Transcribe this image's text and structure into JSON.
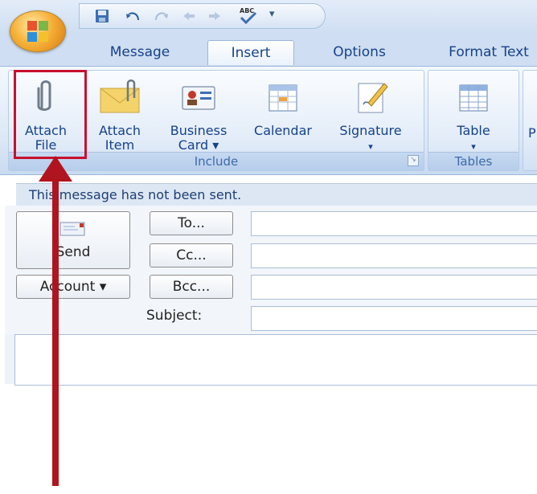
{
  "qat": {
    "icons": [
      "save-icon",
      "undo-icon",
      "redo-icon",
      "previous-item-icon",
      "next-item-icon",
      "spelling-icon"
    ],
    "customize_glyph": "▾"
  },
  "tabs": [
    "Message",
    "Insert",
    "Options",
    "Format Text"
  ],
  "ribbon": {
    "include": {
      "label": "Include",
      "buttons": [
        {
          "line1": "Attach",
          "line2": "File",
          "icon": "paperclip-icon"
        },
        {
          "line1": "Attach",
          "line2": "Item",
          "icon": "envelope-clip-icon"
        },
        {
          "line1": "Business",
          "line2": "Card ▾",
          "icon": "business-card-icon"
        },
        {
          "line1": "Calendar",
          "line2": "",
          "icon": "calendar-icon"
        },
        {
          "line1": "Signature",
          "line2": "▾",
          "icon": "signature-icon"
        }
      ]
    },
    "tables": {
      "label": "Tables",
      "button": {
        "line1": "Table",
        "line2": "▾",
        "icon": "table-icon"
      }
    },
    "partial_next_label": "P"
  },
  "infobar": {
    "text": "This message has not been sent."
  },
  "header": {
    "send": "Send",
    "to": "To...",
    "cc": "Cc...",
    "bcc": "Bcc...",
    "account": "Account ▾",
    "subject_label": "Subject:"
  },
  "colors": {
    "highlight": "#c8102e",
    "arrow": "#b0141e",
    "ribbon_text": "#15428b"
  }
}
